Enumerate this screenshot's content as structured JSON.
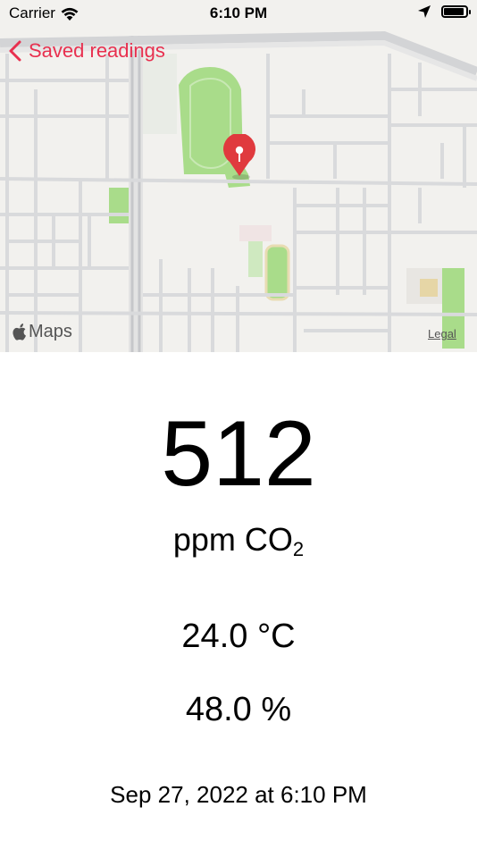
{
  "status_bar": {
    "carrier": "Carrier",
    "time": "6:10 PM",
    "battery_level": 0.9
  },
  "nav": {
    "back_label": "Saved readings"
  },
  "map": {
    "brand_label": "Maps",
    "legal_label": "Legal"
  },
  "reading": {
    "co2_value": "512",
    "co2_unit_prefix": "ppm CO",
    "co2_unit_subscript": "2",
    "temperature": "24.0 °C",
    "humidity": "48.0 %",
    "timestamp": "Sep 27, 2022 at 6:10 PM"
  },
  "colors": {
    "accent": "#e8304f",
    "map_background": "#f2f1ee",
    "park_green": "#a9dc8a",
    "road_gray": "#d9dadc",
    "pin_red": "#e03a3e"
  }
}
